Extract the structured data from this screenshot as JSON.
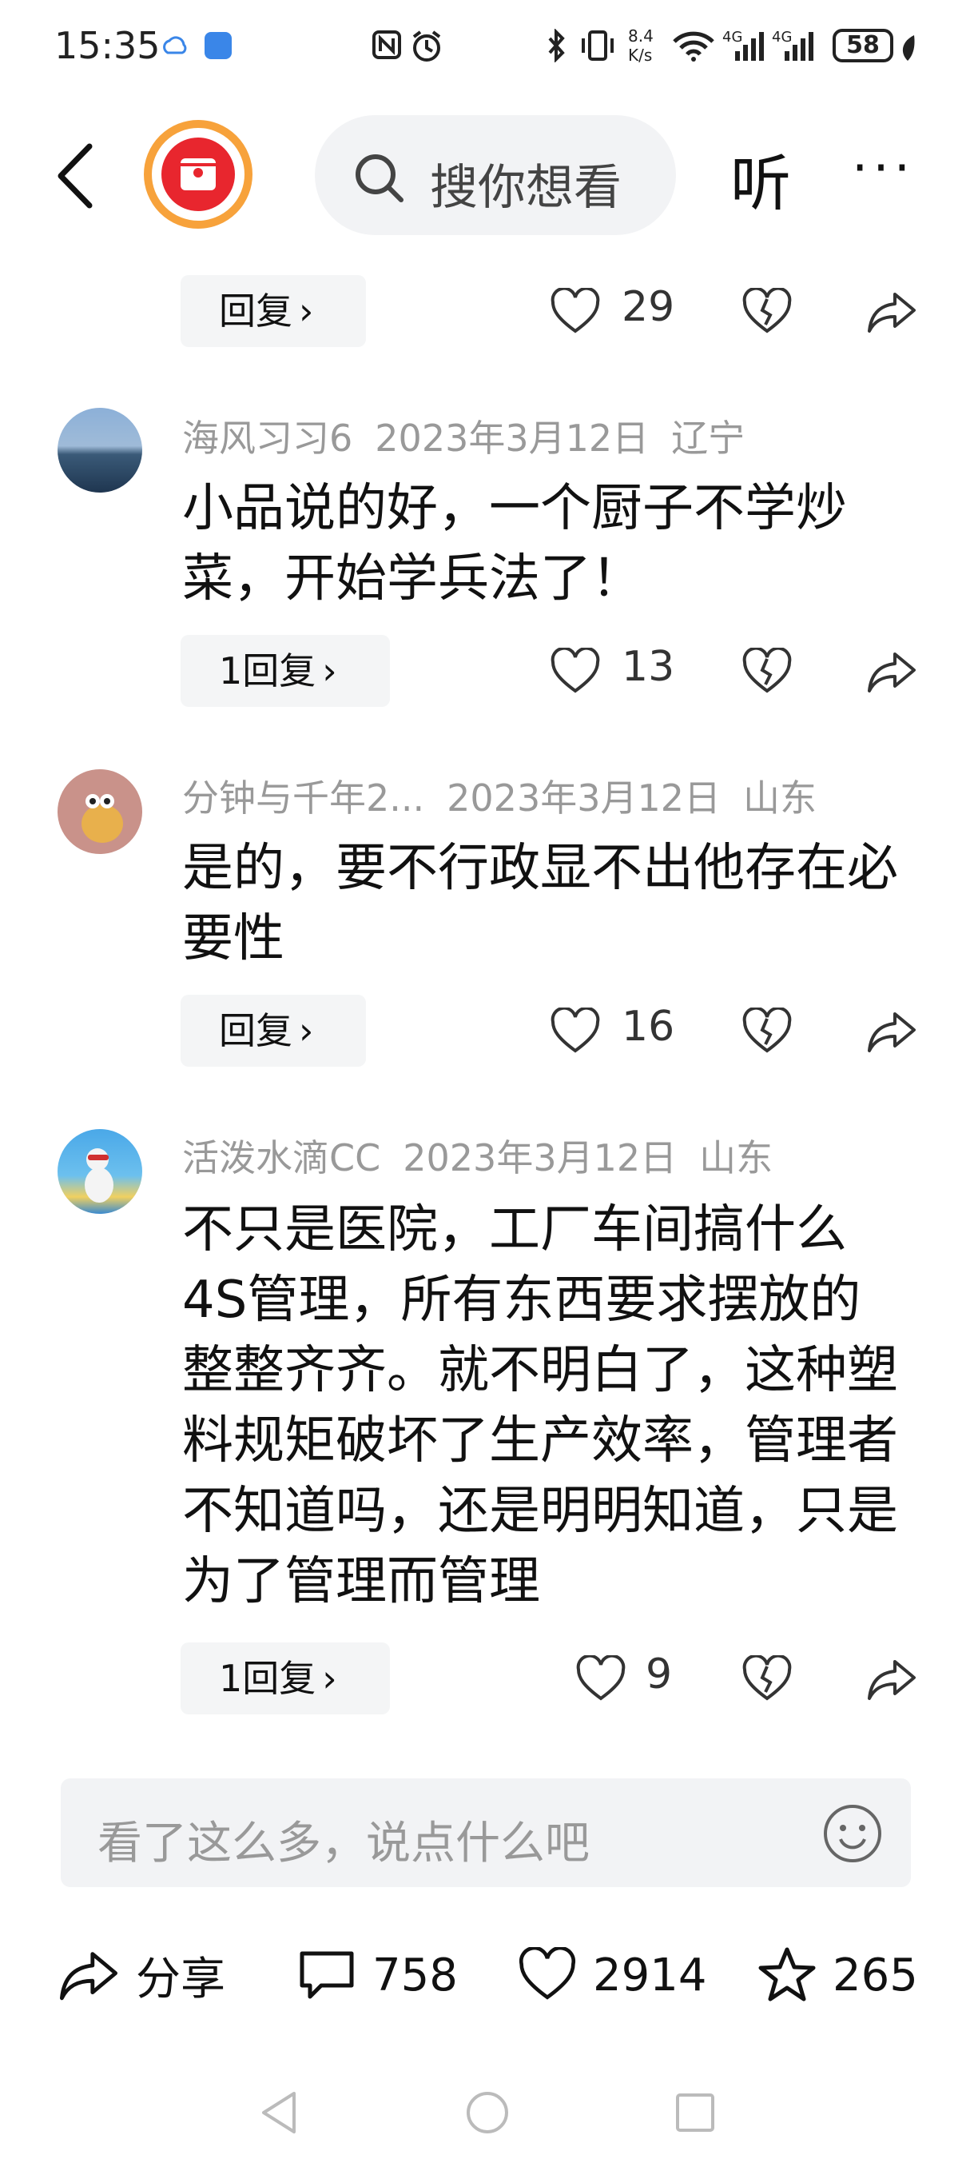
{
  "status_bar": {
    "time": "15:35",
    "net_speed_value": "8.4",
    "net_speed_unit": "K/s",
    "signal1_label": "4G",
    "signal2_label": "4G",
    "battery": "58",
    "icons": [
      "cloud-sync-icon",
      "app-notification-icon",
      "nfc-icon",
      "alarm-icon",
      "bluetooth-icon",
      "vibrate-icon",
      "wifi-icon",
      "signal-icon",
      "leaf-icon"
    ]
  },
  "header": {
    "search_placeholder": "搜你想看",
    "listen_label": "听",
    "more_label": "···",
    "accent_color": "#f7a23b",
    "avatar_color": "#e8262e"
  },
  "top_reply": {
    "reply_label": "回复",
    "likes": "29"
  },
  "comments": [
    {
      "username": "海风习习6",
      "date": "2023年3月12日",
      "location": "辽宁",
      "text": "小品说的好，一个厨子不学炒菜，开始学兵法了！",
      "reply_label": "1回复",
      "likes": "13"
    },
    {
      "username": "分钟与千年2...",
      "date": "2023年3月12日",
      "location": "山东",
      "text": "是的，要不行政显不出他存在必要性",
      "reply_label": "回复",
      "likes": "16"
    },
    {
      "username": "活泼水滴CC",
      "date": "2023年3月12日",
      "location": "山东",
      "text": "不只是医院，工厂车间搞什么4S管理，所有东西要求摆放的整整齐齐。就不明白了，这种塑料规矩破坏了生产效率，管理者不知道吗，还是明明知道，只是为了管理而管理",
      "reply_label": "1回复",
      "likes": "9"
    }
  ],
  "input": {
    "placeholder": "看了这么多，说点什么吧"
  },
  "bottom_bar": {
    "share_label": "分享",
    "comments_count": "758",
    "likes_count": "2914",
    "favorites_count": "265"
  }
}
